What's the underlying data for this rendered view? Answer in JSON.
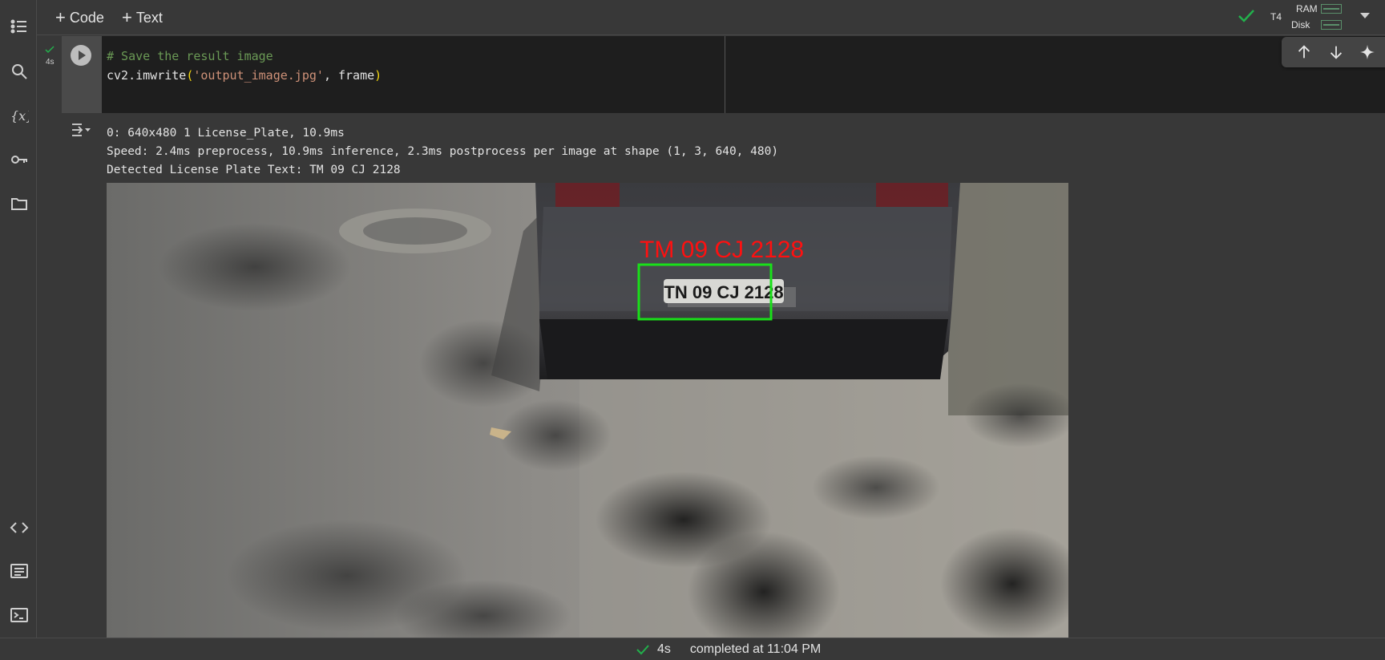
{
  "toolbar_top": {
    "add_code": "Code",
    "add_text": "Text",
    "runtime": "T4",
    "ram_label": "RAM",
    "disk_label": "Disk"
  },
  "cell": {
    "exec_time": "4s",
    "code_comment": "# Save the result image",
    "code_fn": "cv2.imwrite",
    "code_open": "(",
    "code_str": "'output_image.jpg'",
    "code_rest": ", frame",
    "code_close": ")"
  },
  "output": {
    "line1": "0: 640x480 1 License_Plate, 10.9ms",
    "line2": "Speed: 2.4ms preprocess, 10.9ms inference, 2.3ms postprocess per image at shape (1, 3, 640, 480)",
    "line3": "Detected License Plate Text: TM 09 CJ 2128",
    "image": {
      "overlay_text": "TM 09 CJ 2128",
      "plate_text": "TN 09 CJ 2128",
      "box_color": "#19e019",
      "label_color": "#ff1010"
    }
  },
  "statusbar": {
    "duration": "4s",
    "completed": "completed at 11:04 PM"
  },
  "colors": {
    "accent_green": "#22b14c",
    "background": "#383838",
    "editor_bg": "#1e1e1e"
  },
  "icons": [
    "toc-icon",
    "search-icon",
    "variables-icon",
    "key-icon",
    "folder-icon",
    "code-snippets-icon",
    "command-palette-icon",
    "terminal-icon",
    "run-icon",
    "arrow-up-icon",
    "arrow-down-icon",
    "sparkle-icon",
    "link-icon",
    "comment-icon",
    "output-toggle-icon",
    "check-icon",
    "chevron-down-icon"
  ]
}
